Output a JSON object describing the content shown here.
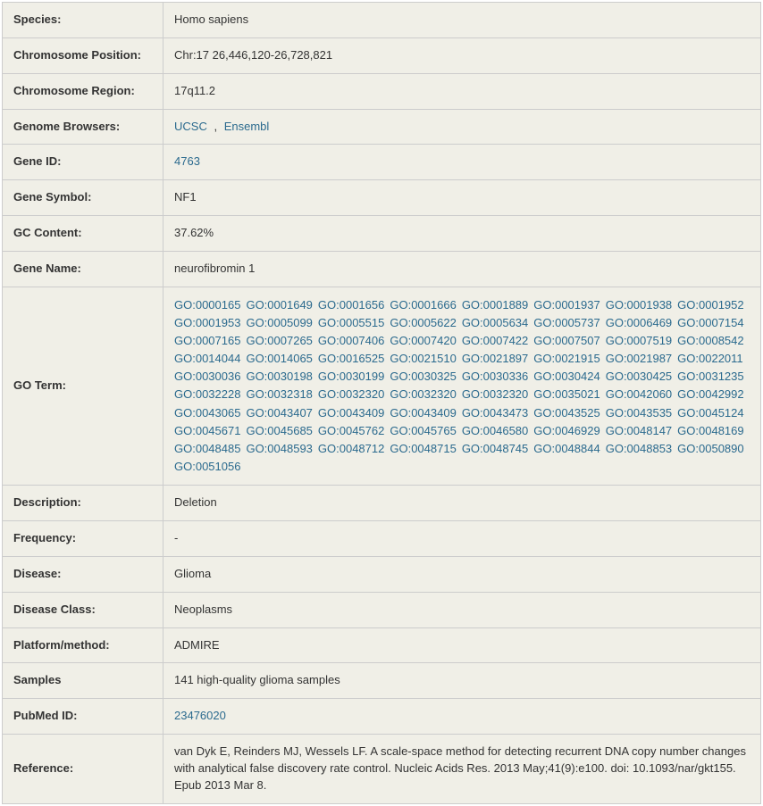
{
  "rows": {
    "species": {
      "label": "Species:",
      "value": "Homo sapiens"
    },
    "chrpos": {
      "label": "Chromosome Position:",
      "value": "Chr:17 26,446,120-26,728,821"
    },
    "chrregion": {
      "label": "Chromosome Region:",
      "value": "17q11.2"
    },
    "browsers": {
      "label": "Genome Browsers:",
      "ucsc": "UCSC",
      "sep": ",",
      "ensembl": "Ensembl"
    },
    "geneid": {
      "label": "Gene ID:",
      "value": "4763"
    },
    "genesym": {
      "label": "Gene Symbol:",
      "value": "NF1"
    },
    "gc": {
      "label": "GC Content:",
      "value": "37.62%"
    },
    "genename": {
      "label": "Gene Name:",
      "value": "neurofibromin 1"
    },
    "goterm": {
      "label": "GO Term:"
    },
    "description": {
      "label": "Description:",
      "value": "Deletion"
    },
    "frequency": {
      "label": "Frequency:",
      "value": "-"
    },
    "disease": {
      "label": "Disease:",
      "value": "Glioma"
    },
    "diseaseclass": {
      "label": "Disease Class:",
      "value": "Neoplasms"
    },
    "platform": {
      "label": "Platform/method:",
      "value": "ADMIRE"
    },
    "samples": {
      "label": "Samples",
      "value": "141 high-quality glioma samples"
    },
    "pubmed": {
      "label": "PubMed ID:",
      "value": "23476020"
    },
    "reference": {
      "label": "Reference:",
      "value": "van Dyk E, Reinders MJ, Wessels LF. A scale-space method for detecting recurrent DNA copy number changes with analytical false discovery rate control. Nucleic Acids Res. 2013 May;41(9):e100. doi: 10.1093/nar/gkt155. Epub 2013 Mar 8."
    }
  },
  "go_terms": [
    "GO:0000165",
    "GO:0001649",
    "GO:0001656",
    "GO:0001666",
    "GO:0001889",
    "GO:0001937",
    "GO:0001938",
    "GO:0001952",
    "GO:0001953",
    "GO:0005099",
    "GO:0005515",
    "GO:0005622",
    "GO:0005634",
    "GO:0005737",
    "GO:0006469",
    "GO:0007154",
    "GO:0007165",
    "GO:0007265",
    "GO:0007406",
    "GO:0007420",
    "GO:0007422",
    "GO:0007507",
    "GO:0007519",
    "GO:0008542",
    "GO:0014044",
    "GO:0014065",
    "GO:0016525",
    "GO:0021510",
    "GO:0021897",
    "GO:0021915",
    "GO:0021987",
    "GO:0022011",
    "GO:0030036",
    "GO:0030198",
    "GO:0030199",
    "GO:0030325",
    "GO:0030336",
    "GO:0030424",
    "GO:0030425",
    "GO:0031235",
    "GO:0032228",
    "GO:0032318",
    "GO:0032320",
    "GO:0032320",
    "GO:0032320",
    "GO:0035021",
    "GO:0042060",
    "GO:0042992",
    "GO:0043065",
    "GO:0043407",
    "GO:0043409",
    "GO:0043409",
    "GO:0043473",
    "GO:0043525",
    "GO:0043535",
    "GO:0045124",
    "GO:0045671",
    "GO:0045685",
    "GO:0045762",
    "GO:0045765",
    "GO:0046580",
    "GO:0046929",
    "GO:0048147",
    "GO:0048169",
    "GO:0048485",
    "GO:0048593",
    "GO:0048712",
    "GO:0048715",
    "GO:0048745",
    "GO:0048844",
    "GO:0048853",
    "GO:0050890",
    "GO:0051056"
  ]
}
